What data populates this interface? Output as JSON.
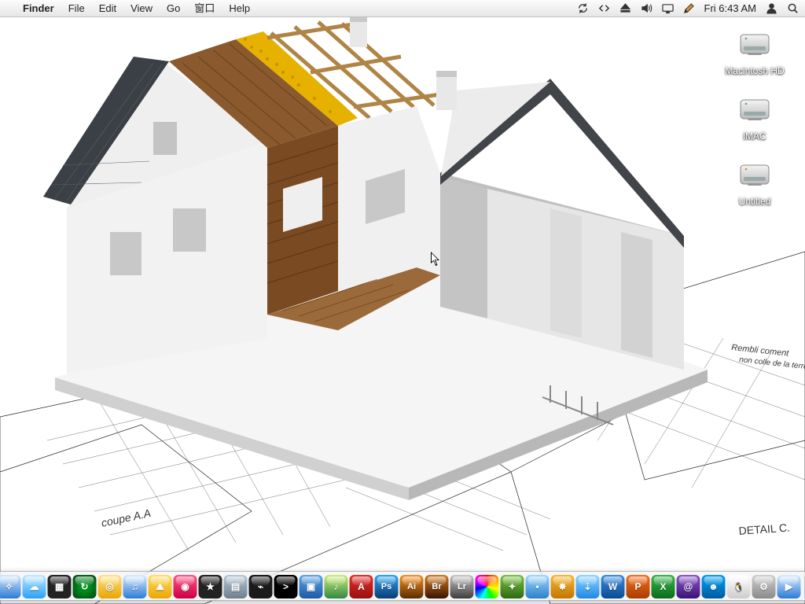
{
  "menubar": {
    "app": "Finder",
    "items": [
      "File",
      "Edit",
      "View",
      "Go",
      "窗口",
      "Help"
    ],
    "right": {
      "clock": "Fri 6:43 AM"
    }
  },
  "desktop": {
    "drives": [
      {
        "label": "Macintosh HD"
      },
      {
        "label": "iMAC"
      },
      {
        "label": "Untitled"
      }
    ]
  },
  "dock": {
    "items": [
      {
        "name": "finder",
        "bg": "linear-gradient(#69b6f2,#1a6fd0)",
        "glyph": "☺"
      },
      {
        "name": "dashboard",
        "bg": "radial-gradient(circle,#333 30%,#111)",
        "glyph": "✦"
      },
      {
        "name": "mail",
        "bg": "linear-gradient(#cfe6ff,#6aa5e8)",
        "glyph": "✉"
      },
      {
        "name": "safari",
        "bg": "linear-gradient(#d6e9fb,#2d7bd8)",
        "glyph": "✧"
      },
      {
        "name": "ichat",
        "bg": "linear-gradient(#bfe9ff,#2aa1f2)",
        "glyph": "☁"
      },
      {
        "name": "spaces",
        "bg": "#222",
        "glyph": "▦"
      },
      {
        "name": "timemachine",
        "bg": "radial-gradient(circle,#0a2,#041)",
        "glyph": "↻"
      },
      {
        "name": "iweb",
        "bg": "linear-gradient(#ffe28a,#e9a500)",
        "glyph": "◎"
      },
      {
        "name": "itunes",
        "bg": "linear-gradient(#d9ecff,#2d7bd8)",
        "glyph": "♫"
      },
      {
        "name": "iphoto",
        "bg": "linear-gradient(#ffdf6b,#e9a500)",
        "glyph": "⛰"
      },
      {
        "name": "photobooth",
        "bg": "linear-gradient(#f58,#c04)",
        "glyph": "◉"
      },
      {
        "name": "imovie",
        "bg": "#222",
        "glyph": "★"
      },
      {
        "name": "expose",
        "bg": "linear-gradient(#b7c7d5,#6d7f8f)",
        "glyph": "▤"
      },
      {
        "name": "activity",
        "bg": "#1a1a1a",
        "glyph": "⌁"
      },
      {
        "name": "terminal",
        "bg": "#000",
        "glyph": ">"
      },
      {
        "name": "preview",
        "bg": "linear-gradient(#5fa5e0,#1c5aa8)",
        "glyph": "▣"
      },
      {
        "name": "garageband",
        "bg": "linear-gradient(#ce7,#384)",
        "glyph": "♪"
      },
      {
        "name": "acrobat",
        "bg": "linear-gradient(#e1302a,#9a0f0f)",
        "glyph": "A"
      },
      {
        "name": "photoshop",
        "bg": "linear-gradient(#2aa6f2,#0b3a73)",
        "glyph": "Ps"
      },
      {
        "name": "illustrator",
        "bg": "linear-gradient(#f7931e,#5a2b00)",
        "glyph": "Ai"
      },
      {
        "name": "bridge",
        "bg": "linear-gradient(#d17a1f,#3a1500)",
        "glyph": "Br"
      },
      {
        "name": "lightroom",
        "bg": "linear-gradient(#c8c8c8,#3d3d3d)",
        "glyph": "Lr"
      },
      {
        "name": "colorpicker",
        "bg": "conic-gradient(red,orange,yellow,lime,cyan,blue,magenta,red)",
        "glyph": ""
      },
      {
        "name": "xscope",
        "bg": "linear-gradient(#7ac241,#2e6a12)",
        "glyph": "✦"
      },
      {
        "name": "app-a",
        "bg": "linear-gradient(#9fd7ff,#2c7fcb)",
        "glyph": "•"
      },
      {
        "name": "app-b",
        "bg": "linear-gradient(#f7b733,#c47600)",
        "glyph": "✸"
      },
      {
        "name": "app-c",
        "bg": "linear-gradient(#8ed6ff,#1e88e5)",
        "glyph": "⇣"
      },
      {
        "name": "word",
        "bg": "linear-gradient(#3a8dde,#0b4a94)",
        "glyph": "W"
      },
      {
        "name": "powerpoint",
        "bg": "linear-gradient(#f36f21,#a83d00)",
        "glyph": "P"
      },
      {
        "name": "excel",
        "bg": "linear-gradient(#3bb54a,#0b6b1d)",
        "glyph": "X"
      },
      {
        "name": "entourage",
        "bg": "linear-gradient(#8e57c9,#3a1278)",
        "glyph": "@"
      },
      {
        "name": "msn",
        "bg": "linear-gradient(#00a1f1,#005ba1)",
        "glyph": "☻"
      },
      {
        "name": "qq",
        "bg": "linear-gradient(#fff,#ccc)",
        "glyph": "🐧"
      },
      {
        "name": "systemprefs",
        "bg": "linear-gradient(#cfcfcf,#8a8a8a)",
        "glyph": "⚙"
      },
      {
        "name": "quicktime",
        "bg": "linear-gradient(#d9ecff,#2d7bd8)",
        "glyph": "▶"
      }
    ],
    "right": [
      {
        "name": "downloads",
        "bg": "linear-gradient(#9fc4ea,#4c7db3)",
        "glyph": "⬇"
      },
      {
        "name": "documents",
        "bg": "linear-gradient(#bcd4ec,#6994c9)",
        "glyph": "▇"
      },
      {
        "name": "trash",
        "bg": "linear-gradient(#e8e8e8,#a9a9a9)",
        "glyph": "🗑"
      }
    ]
  }
}
